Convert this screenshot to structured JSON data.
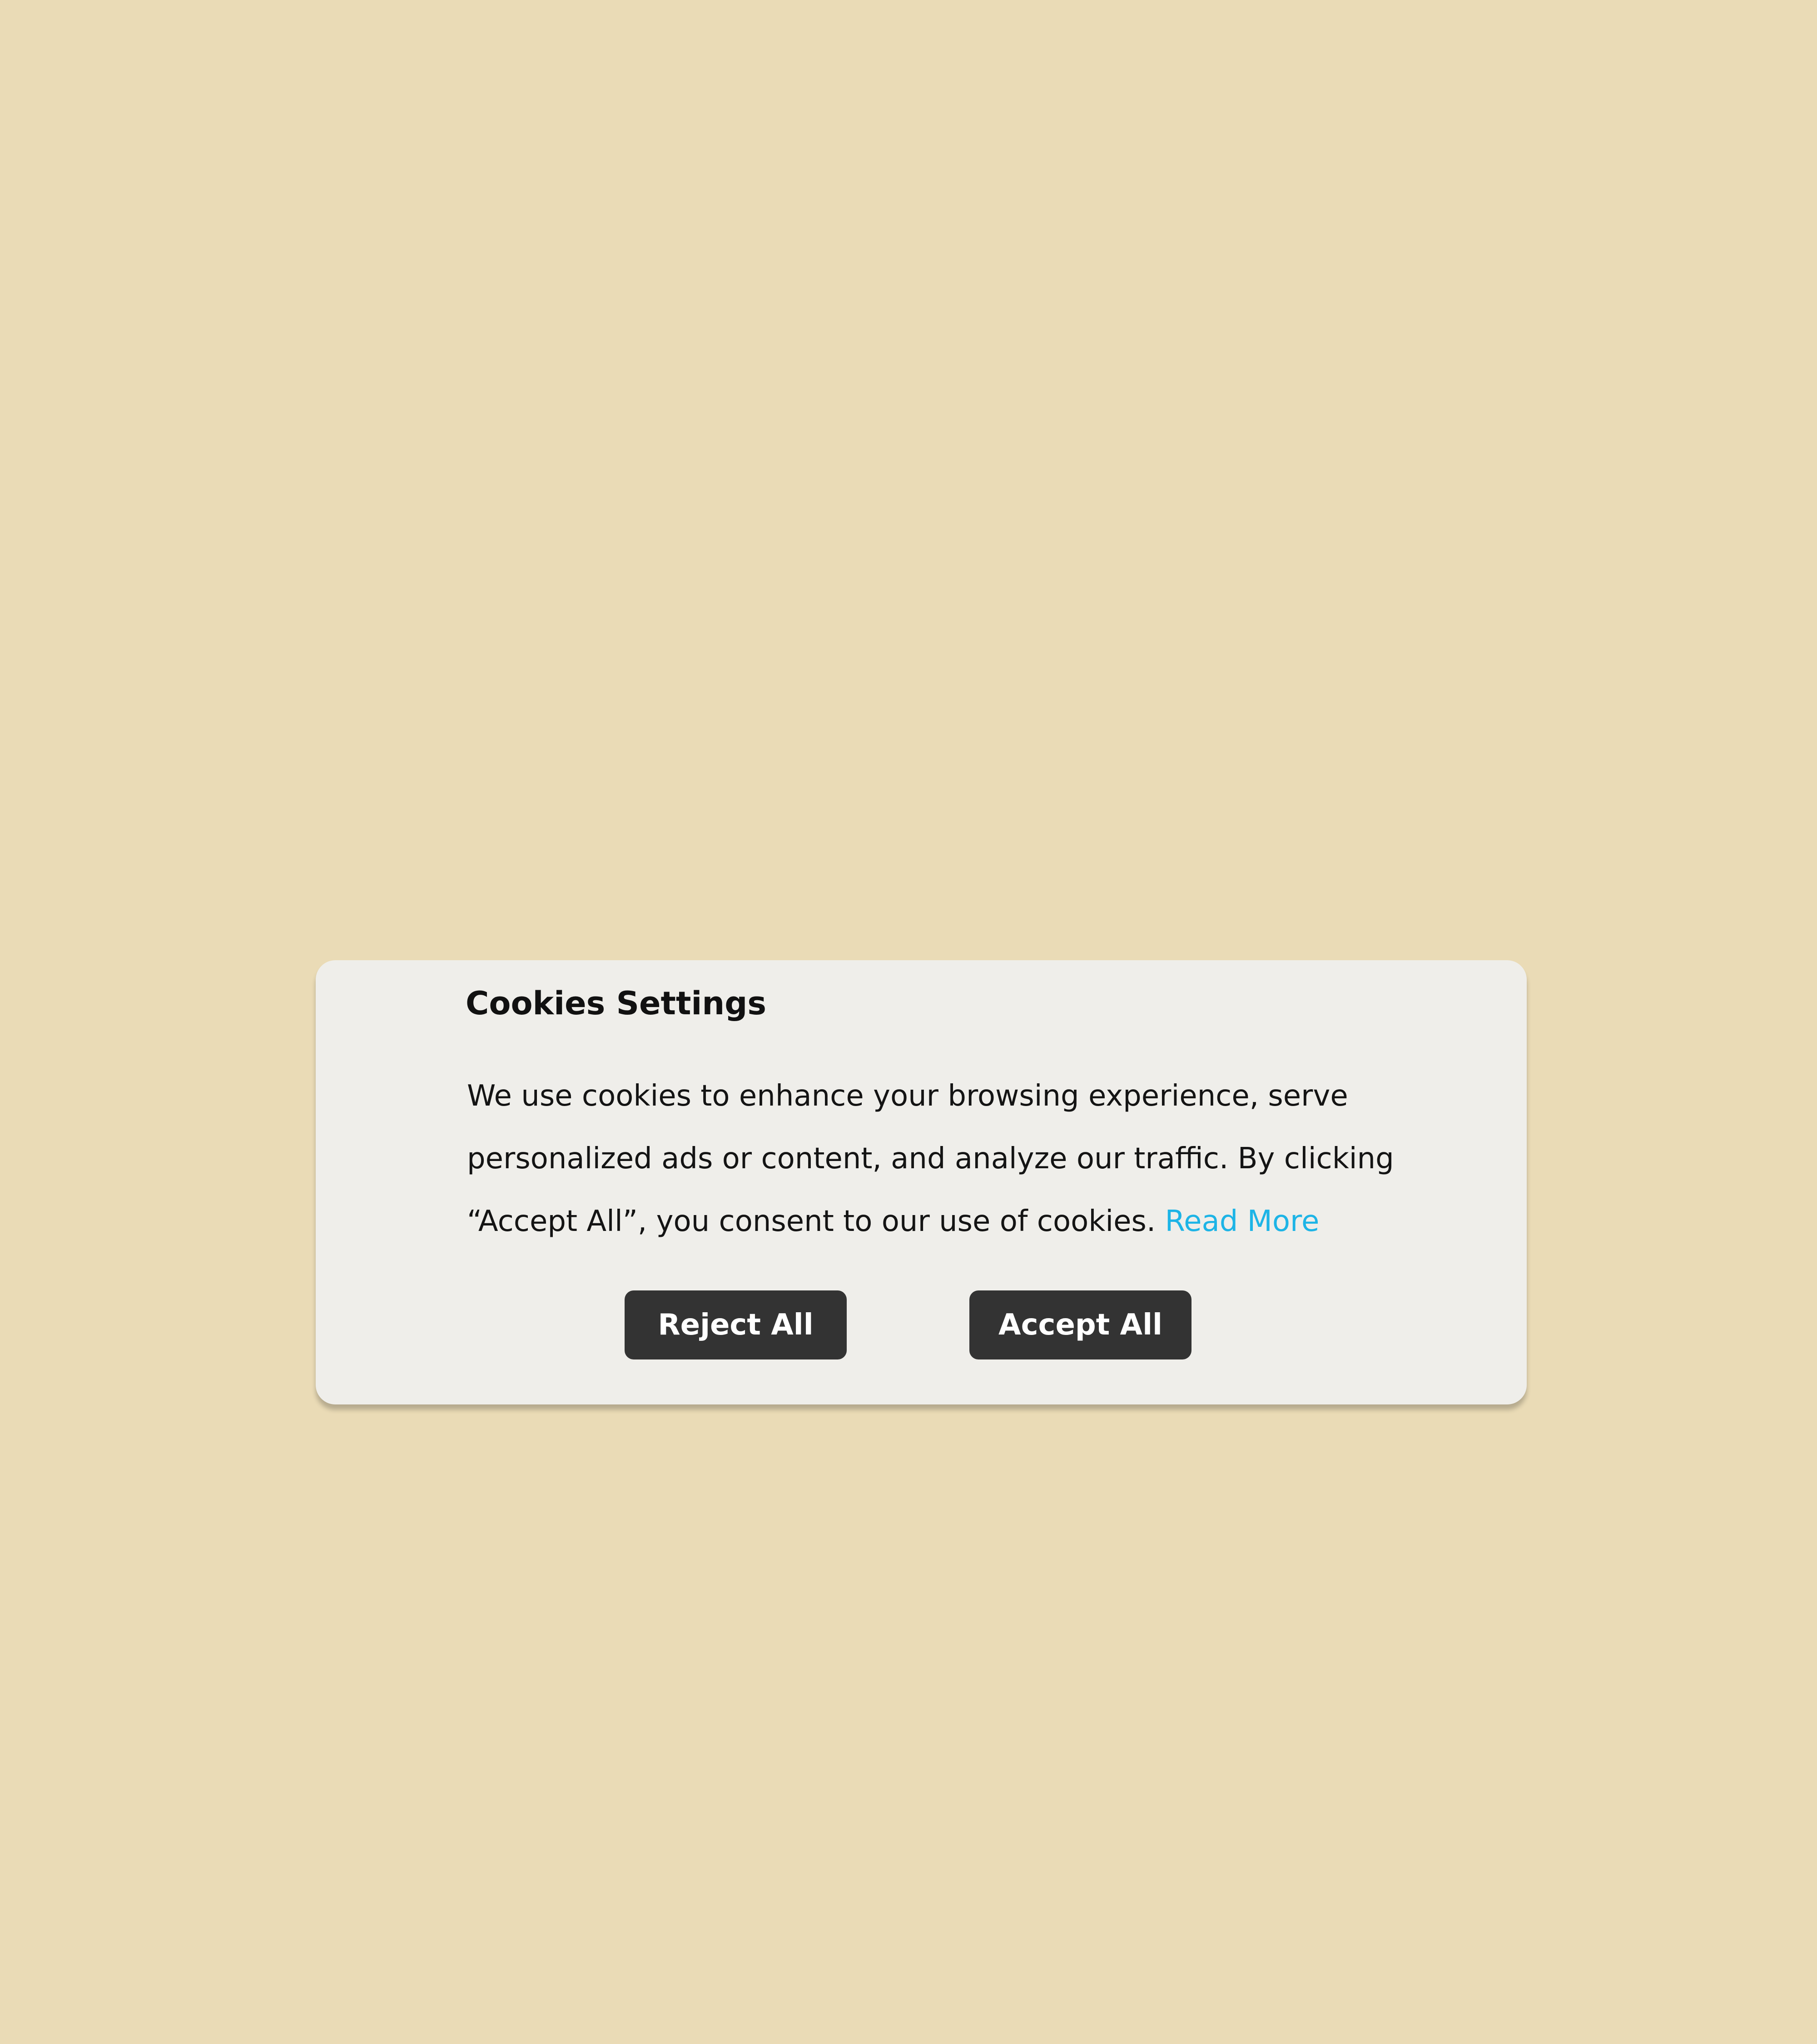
{
  "dialog": {
    "title": "Cookies Settings",
    "body_lines": [
      "We use cookies to enhance your browsing experience, serve",
      "personalized ads or content, and analyze our traffic. By clicking",
      "“Accept All”, you consent to our use of cookies. "
    ],
    "read_more_label": "Read More",
    "reject_label": "Reject All",
    "accept_label": "Accept All"
  },
  "colors": {
    "page_background": "#EADBB6",
    "dialog_background": "#EFEEEA",
    "button_background": "#333333",
    "link": "#1DB4E6"
  }
}
